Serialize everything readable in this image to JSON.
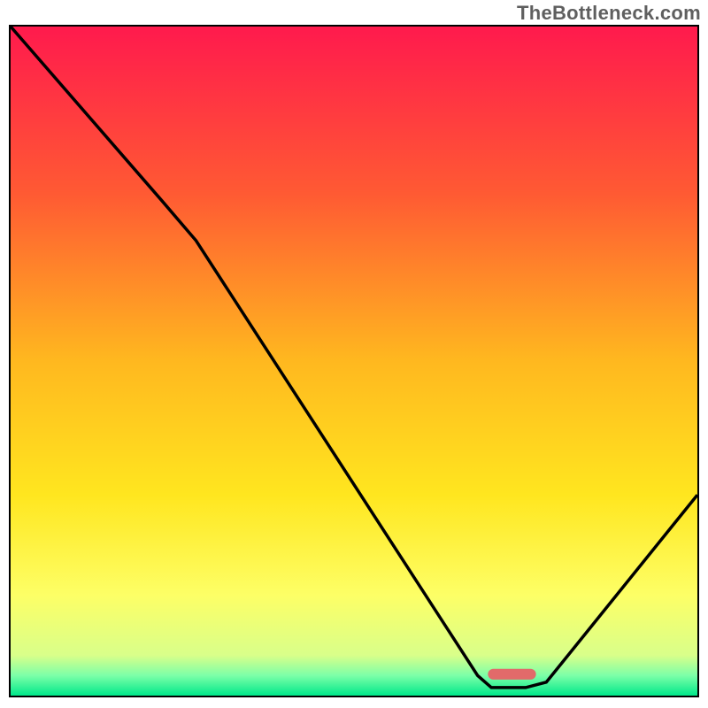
{
  "watermark_text": "TheBottleneck.com",
  "chart_data": {
    "type": "line",
    "title": "",
    "xlabel": "",
    "ylabel": "",
    "x_range": [
      0,
      100
    ],
    "y_range": [
      0,
      100
    ],
    "legend": [],
    "annotations": [],
    "color_stops": [
      {
        "offset": 0.0,
        "color": "#ff1a4d"
      },
      {
        "offset": 0.25,
        "color": "#ff5a33"
      },
      {
        "offset": 0.5,
        "color": "#ffb81f"
      },
      {
        "offset": 0.7,
        "color": "#ffe61f"
      },
      {
        "offset": 0.85,
        "color": "#fdff66"
      },
      {
        "offset": 0.94,
        "color": "#d9ff8a"
      },
      {
        "offset": 0.97,
        "color": "#7cffa8"
      },
      {
        "offset": 1.0,
        "color": "#00e88a"
      }
    ],
    "curve_points": [
      {
        "x": 0,
        "y": 100
      },
      {
        "x": 22,
        "y": 74
      },
      {
        "x": 27,
        "y": 68
      },
      {
        "x": 68,
        "y": 3
      },
      {
        "x": 70,
        "y": 1.2
      },
      {
        "x": 75,
        "y": 1.2
      },
      {
        "x": 78,
        "y": 2
      },
      {
        "x": 100,
        "y": 30
      }
    ],
    "marker": {
      "x": 73,
      "y": 3.2,
      "w": 7,
      "h": 1.6,
      "color": "#e26a6a"
    }
  }
}
